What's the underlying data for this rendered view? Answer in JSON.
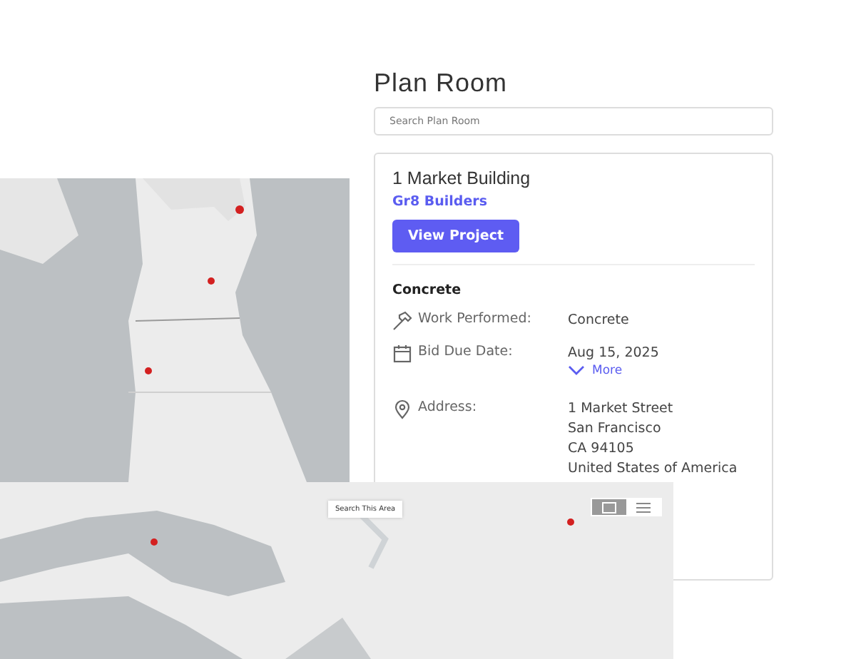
{
  "title": "Plan Room",
  "search": {
    "placeholder": "Search Plan Room"
  },
  "project": {
    "name": "1 Market Building",
    "company": "Gr8 Builders",
    "button": "View Project",
    "section": "Concrete",
    "fields": [
      {
        "kind": "hammer",
        "label": "Work Performed:",
        "lines": [
          "Concrete"
        ]
      },
      {
        "kind": "calendar",
        "label": "Bid Due Date:",
        "lines": [
          "Aug 15, 2025"
        ],
        "more": "More"
      },
      {
        "kind": "pin",
        "label": "Address:",
        "lines": [
          "1 Market Street",
          "San Francisco",
          "CA 94105",
          "United States of America"
        ]
      }
    ]
  },
  "map": {
    "search_button": "Search This Area",
    "view_toggle": [
      {
        "kind": "map",
        "selected": true
      },
      {
        "kind": "list",
        "selected": false
      }
    ]
  }
}
